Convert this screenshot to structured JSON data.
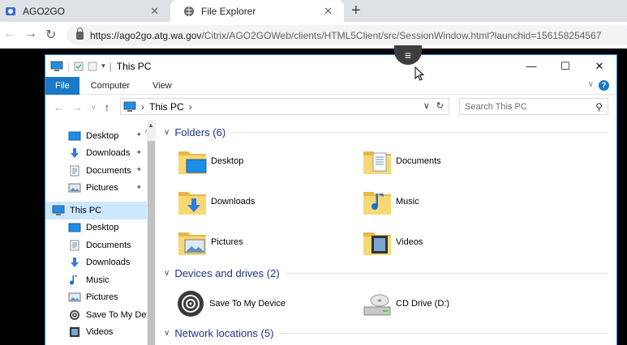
{
  "browser": {
    "tabs": [
      {
        "label": "AGO2GO",
        "active": false
      },
      {
        "label": "File Explorer",
        "active": true
      }
    ],
    "url_host": "https://ago2go.atg.wa.gov",
    "url_path": "/Citrix/AGO2GOWeb/clients/HTML5Client/src/SessionWindow.html?launchid=156158254567"
  },
  "explorer": {
    "title": "This PC",
    "ribbon_tabs": [
      "File",
      "Computer",
      "View"
    ],
    "address_crumb": "This PC",
    "search_placeholder": "Search This PC",
    "nav_quick": [
      {
        "label": "Desktop",
        "icon": "desktop-icon",
        "pinned": true
      },
      {
        "label": "Downloads",
        "icon": "downloads-icon",
        "pinned": true
      },
      {
        "label": "Documents",
        "icon": "documents-icon",
        "pinned": true
      },
      {
        "label": "Pictures",
        "icon": "pictures-icon",
        "pinned": true
      }
    ],
    "nav_this_pc": "This PC",
    "nav_pc_items": [
      {
        "label": "Desktop",
        "icon": "desktop-icon"
      },
      {
        "label": "Documents",
        "icon": "documents-icon"
      },
      {
        "label": "Downloads",
        "icon": "downloads-icon"
      },
      {
        "label": "Music",
        "icon": "music-icon"
      },
      {
        "label": "Pictures",
        "icon": "pictures-icon"
      },
      {
        "label": "Save To My Devi",
        "icon": "save-device-icon"
      },
      {
        "label": "Videos",
        "icon": "videos-icon"
      },
      {
        "label": "CD Drive (D:)",
        "icon": "cd-drive-icon"
      }
    ],
    "groups": {
      "folders": "Folders (6)",
      "devices": "Devices and drives (2)",
      "network": "Network locations (5)"
    },
    "folders": [
      {
        "label": "Desktop",
        "icon": "desktop-folder-icon"
      },
      {
        "label": "Documents",
        "icon": "documents-folder-icon"
      },
      {
        "label": "Downloads",
        "icon": "downloads-folder-icon"
      },
      {
        "label": "Music",
        "icon": "music-folder-icon"
      },
      {
        "label": "Pictures",
        "icon": "pictures-folder-icon"
      },
      {
        "label": "Videos",
        "icon": "videos-folder-icon"
      }
    ],
    "devices": [
      {
        "label": "Save To My Device",
        "icon": "save-device-icon"
      },
      {
        "label": "CD Drive (D:)",
        "icon": "cd-drive-icon"
      }
    ]
  }
}
